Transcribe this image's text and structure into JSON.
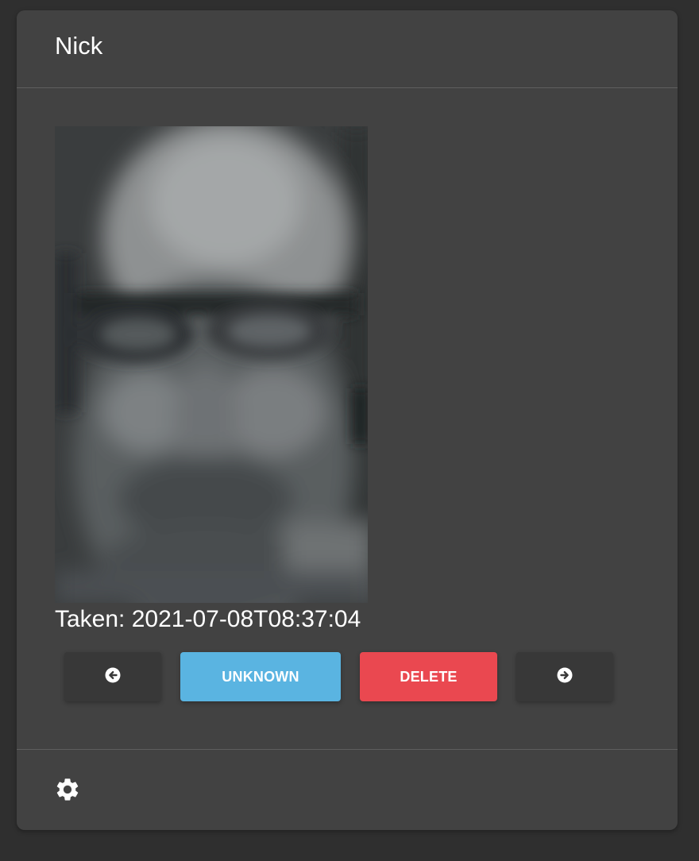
{
  "card": {
    "title": "Nick"
  },
  "photo": {
    "alt": "Blurred face photo of Nick"
  },
  "taken": {
    "text": "Taken: 2021-07-08T08:37:04"
  },
  "buttons": {
    "prev_icon": "arrow-left-circle-icon",
    "unknown_label": "UNKNOWN",
    "delete_label": "DELETE",
    "next_icon": "arrow-right-circle-icon"
  },
  "footer": {
    "settings_icon": "gear-icon"
  },
  "colors": {
    "background": "#2f2f2f",
    "card": "#424242",
    "unknown": "#5ab4e1",
    "delete": "#ea4850",
    "nav_button": "#383838"
  }
}
